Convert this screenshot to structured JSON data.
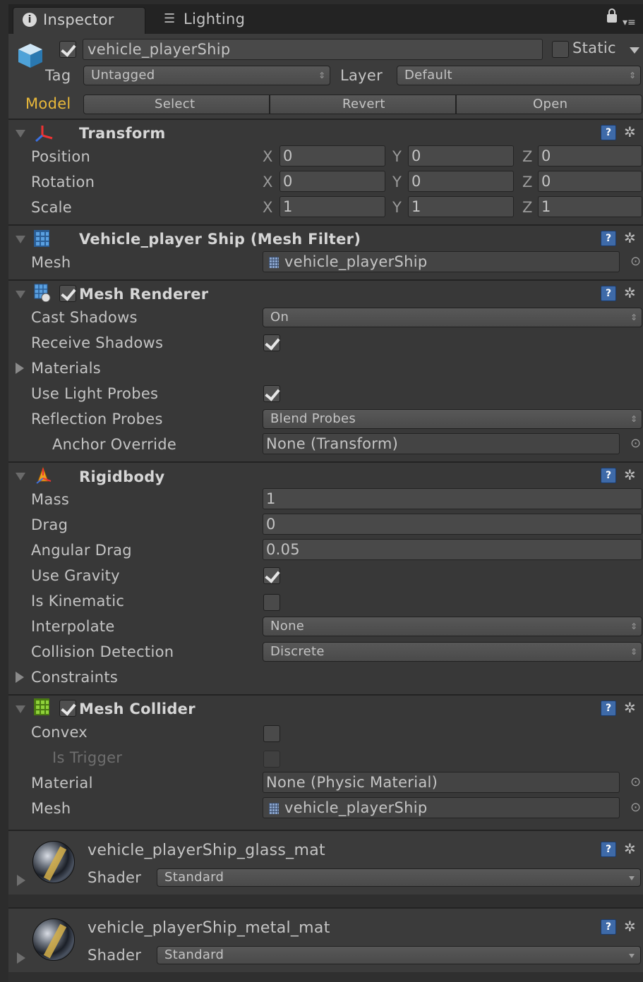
{
  "tabs": [
    {
      "label": "Inspector",
      "icon": "info-icon"
    },
    {
      "label": "Lighting",
      "icon": "lighting-icon"
    }
  ],
  "object": {
    "name": "vehicle_playerShip",
    "active": true,
    "static_label": "Static",
    "tag_label": "Tag",
    "tag_value": "Untagged",
    "layer_label": "Layer",
    "layer_value": "Default"
  },
  "model": {
    "label": "Model",
    "select": "Select",
    "revert": "Revert",
    "open": "Open"
  },
  "transform": {
    "title": "Transform",
    "rows": [
      {
        "label": "Position",
        "x": "0",
        "y": "0",
        "z": "0"
      },
      {
        "label": "Rotation",
        "x": "0",
        "y": "0",
        "z": "0"
      },
      {
        "label": "Scale",
        "x": "1",
        "y": "1",
        "z": "1"
      }
    ],
    "axis_x": "X",
    "axis_y": "Y",
    "axis_z": "Z"
  },
  "mesh_filter": {
    "title": "Vehicle_player Ship (Mesh Filter)",
    "mesh_label": "Mesh",
    "mesh_value": "vehicle_playerShip"
  },
  "mesh_renderer": {
    "title": "Mesh Renderer",
    "enabled": true,
    "cast_shadows_label": "Cast Shadows",
    "cast_shadows_value": "On",
    "receive_shadows_label": "Receive Shadows",
    "receive_shadows": true,
    "materials_label": "Materials",
    "use_light_probes_label": "Use Light Probes",
    "use_light_probes": true,
    "reflection_probes_label": "Reflection Probes",
    "reflection_probes_value": "Blend Probes",
    "anchor_override_label": "Anchor Override",
    "anchor_override_value": "None (Transform)"
  },
  "rigidbody": {
    "title": "Rigidbody",
    "mass_label": "Mass",
    "mass_value": "1",
    "drag_label": "Drag",
    "drag_value": "0",
    "angular_drag_label": "Angular Drag",
    "angular_drag_value": "0.05",
    "use_gravity_label": "Use Gravity",
    "use_gravity": true,
    "is_kinematic_label": "Is Kinematic",
    "is_kinematic": false,
    "interpolate_label": "Interpolate",
    "interpolate_value": "None",
    "collision_label": "Collision Detection",
    "collision_value": "Discrete",
    "constraints_label": "Constraints"
  },
  "mesh_collider": {
    "title": "Mesh Collider",
    "enabled": true,
    "convex_label": "Convex",
    "convex": false,
    "is_trigger_label": "Is Trigger",
    "is_trigger": false,
    "material_label": "Material",
    "material_value": "None (Physic Material)",
    "mesh_label": "Mesh",
    "mesh_value": "vehicle_playerShip"
  },
  "materials": [
    {
      "name": "vehicle_playerShip_glass_mat",
      "shader_label": "Shader",
      "shader_value": "Standard"
    },
    {
      "name": "vehicle_playerShip_metal_mat",
      "shader_label": "Shader",
      "shader_value": "Standard"
    }
  ],
  "colors": {
    "background": "#383838",
    "model_label": "#e8b83a",
    "help_icon": "#3e6aa8"
  }
}
